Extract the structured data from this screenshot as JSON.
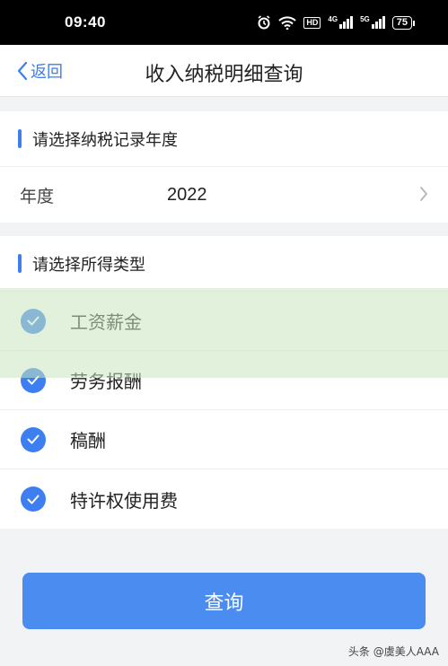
{
  "status_bar": {
    "time": "09:40",
    "icons": [
      "alarm-icon",
      "wifi-icon",
      "hd-icon",
      "signal-4g-icon",
      "signal-5g-icon"
    ],
    "hd": "HD",
    "net1": "4G",
    "net2": "5G",
    "battery": "75"
  },
  "nav": {
    "back_label": "返回",
    "title": "收入纳税明细查询"
  },
  "year_section": {
    "header": "请选择纳税记录年度",
    "label": "年度",
    "value": "2022"
  },
  "income_section": {
    "header": "请选择所得类型",
    "items": [
      {
        "label": "工资薪金",
        "checked": true
      },
      {
        "label": "劳务报酬",
        "checked": true
      },
      {
        "label": "稿酬",
        "checked": true
      },
      {
        "label": "特许权使用费",
        "checked": true
      }
    ]
  },
  "query_button": "查询",
  "credit": "头条 @虞美人AAA",
  "colors": {
    "accent": "#3d7ef0",
    "button": "#4a8cf0",
    "background": "#f2f3f5"
  }
}
